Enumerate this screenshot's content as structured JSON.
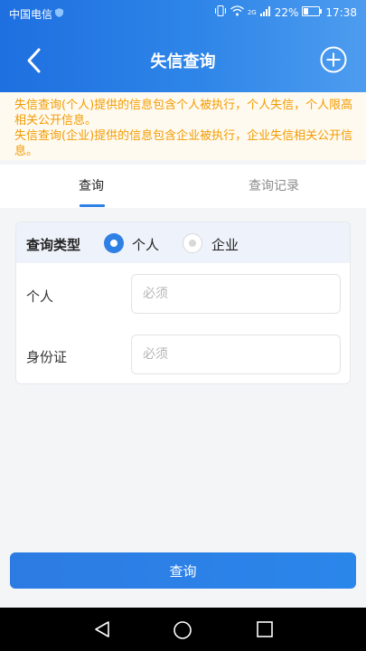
{
  "status_bar": {
    "carrier": "中国电信",
    "network": "2G",
    "battery": "22%",
    "time": "17:38"
  },
  "header": {
    "title": "失信查询"
  },
  "notice": {
    "line1": "失信查询(个人)提供的信息包含个人被执行，个人失信，个人限高相关公开信息。",
    "line2": "失信查询(企业)提供的信息包含企业被执行，企业失信相关公开信息。"
  },
  "tabs": [
    {
      "label": "查询",
      "active": true
    },
    {
      "label": "查询记录",
      "active": false
    }
  ],
  "form": {
    "type_label": "查询类型",
    "options": [
      {
        "label": "个人",
        "selected": true
      },
      {
        "label": "企业",
        "selected": false
      }
    ],
    "fields": [
      {
        "label": "个人",
        "placeholder": "必须",
        "value": ""
      },
      {
        "label": "身份证",
        "placeholder": "必须",
        "value": ""
      }
    ]
  },
  "submit": {
    "label": "查询"
  },
  "colors": {
    "accent": "#2f80e4",
    "notice_text": "#f29b00"
  }
}
